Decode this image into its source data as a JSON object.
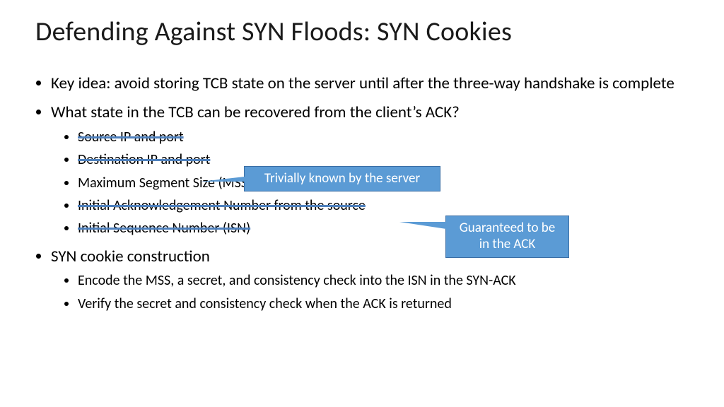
{
  "title": "Defending Against SYN Floods: SYN Cookies",
  "bullets": {
    "b1": "Key idea: avoid storing TCB state on the server until after the three-way handshake is complete",
    "b2": "What state in the TCB can be recovered from the client’s ACK?",
    "b2_sub": {
      "s1": "Source IP and port",
      "s2": "Destination IP and port",
      "s3": "Maximum Segment Size (MSS) for the connection",
      "s4": "Initial Acknowledgement Number from the source",
      "s5": "Initial Sequence Number (ISN)"
    },
    "b3": "SYN cookie construction",
    "b3_sub": {
      "s1": "Encode the MSS, a secret, and consistency check into the ISN in the SYN-ACK",
      "s2": "Verify the secret and consistency check when the ACK is returned"
    }
  },
  "callouts": {
    "trivial": "Trivially known by the server",
    "ack": "Guaranteed to be in the ACK"
  },
  "struck_items": [
    "s1",
    "s2",
    "s4",
    "s5"
  ],
  "callout_colors": {
    "fill": "#5b9bd5",
    "border": "#3a6ea5",
    "strike": "#4f81bd"
  }
}
